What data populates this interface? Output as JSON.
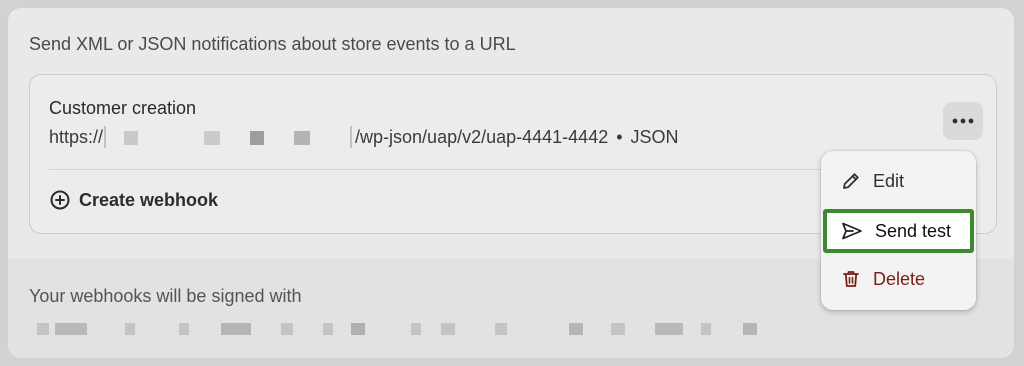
{
  "section": {
    "intro": "Send XML or JSON notifications about store events to a URL"
  },
  "webhook": {
    "event": "Customer creation",
    "url_prefix": "https://",
    "url_suffix": "/wp-json/uap/v2/uap-4441-4442",
    "separator": "•",
    "format": "JSON"
  },
  "create_webhook_label": "Create webhook",
  "signing": {
    "label": "Your webhooks will be signed with"
  },
  "menu": {
    "edit": "Edit",
    "send_test": "Send test",
    "delete": "Delete"
  },
  "colors": {
    "highlight": "#3c8a2e",
    "delete": "#7a1f16"
  },
  "icons": {
    "more": "ellipsis-icon",
    "create": "plus-circle-icon",
    "edit": "pencil-icon",
    "send": "send-icon",
    "delete": "trash-icon"
  }
}
